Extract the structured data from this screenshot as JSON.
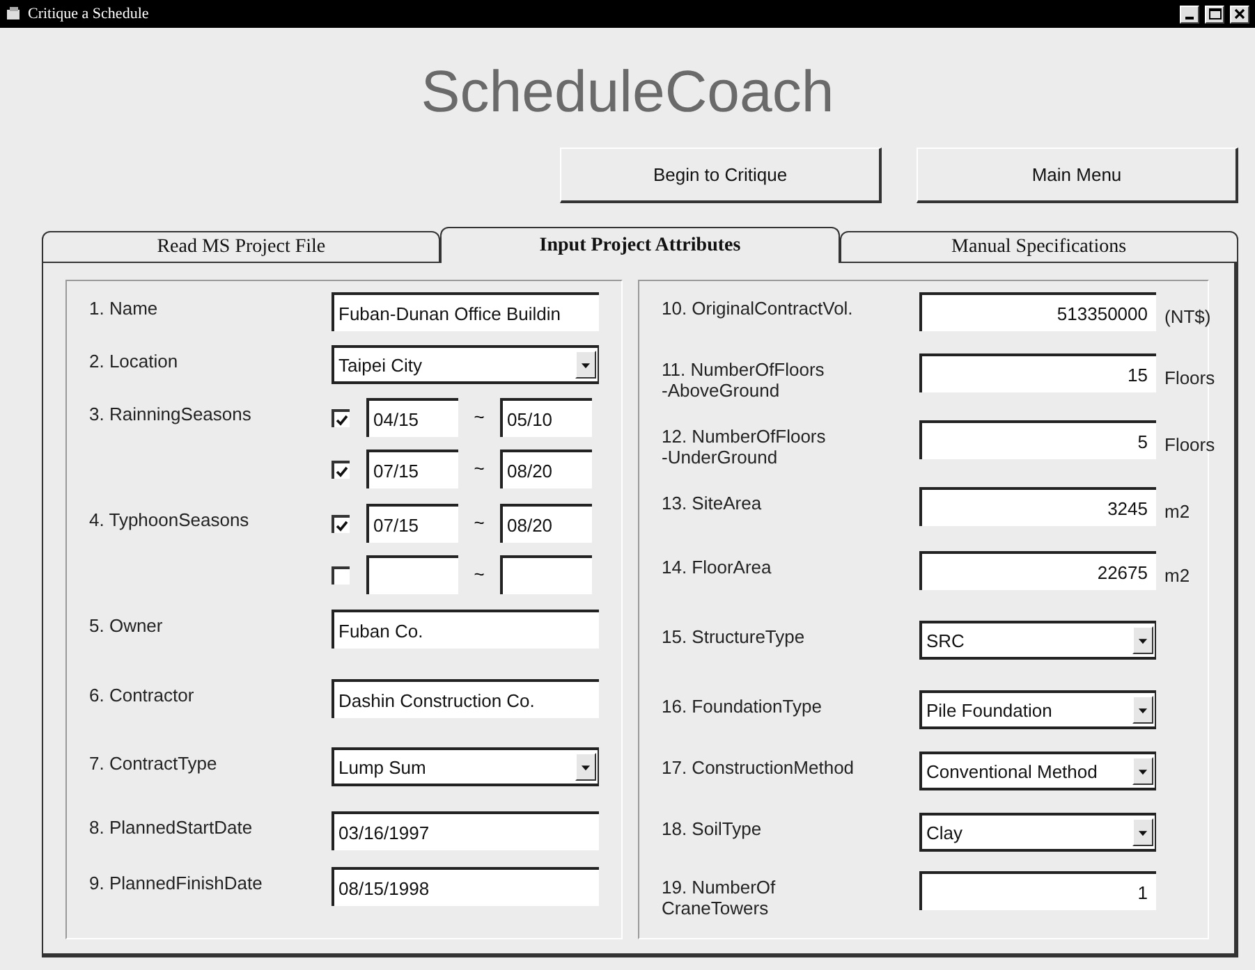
{
  "window": {
    "title": "Critique a Schedule"
  },
  "app_title": "ScheduleCoach",
  "buttons": [
    "Begin to Critique",
    "Main Menu"
  ],
  "tabs": [
    {
      "label": "Read MS Project File",
      "selected": false
    },
    {
      "label": "Input Project Attributes",
      "selected": true
    },
    {
      "label": "Manual Specifications",
      "selected": false
    }
  ],
  "left_fields": [
    {
      "kind": "text",
      "label": "1. Name",
      "value": "Fuban-Dunan Office Buildin"
    },
    {
      "kind": "select",
      "label": "2. Location",
      "value": "Taipei City"
    },
    {
      "kind": "seasons",
      "label": "3. RainningSeasons",
      "rows": [
        {
          "checked": true,
          "from": "04/15",
          "separator": "~",
          "to": "05/10"
        },
        {
          "checked": true,
          "from": "07/15",
          "separator": "~",
          "to": "08/20"
        }
      ]
    },
    {
      "kind": "seasons",
      "label": "4. TyphoonSeasons",
      "rows": [
        {
          "checked": true,
          "from": "07/15",
          "separator": "~",
          "to": "08/20"
        },
        {
          "checked": false,
          "separator": "~"
        }
      ]
    },
    {
      "kind": "text",
      "label": "5. Owner",
      "value": "Fuban Co."
    },
    {
      "kind": "text",
      "label": "6. Contractor",
      "value": "Dashin Construction Co."
    },
    {
      "kind": "select",
      "label": "7. ContractType",
      "value": "Lump Sum"
    },
    {
      "kind": "text",
      "label": "8. PlannedStartDate",
      "value": "03/16/1997"
    },
    {
      "kind": "text",
      "label": "9. PlannedFinishDate",
      "value": "08/15/1998"
    }
  ],
  "right_fields": [
    {
      "kind": "number",
      "label": "10. OriginalContractVol.",
      "value": "513350000",
      "unit": "(NT$)"
    },
    {
      "kind": "number",
      "label": "11. NumberOfFloors\n-AboveGround",
      "value": "15",
      "unit": "Floors"
    },
    {
      "kind": "number",
      "label": "12. NumberOfFloors\n-UnderGround",
      "value": "5",
      "unit": "Floors"
    },
    {
      "kind": "number",
      "label": "13. SiteArea",
      "value": "3245",
      "unit": "m2"
    },
    {
      "kind": "number",
      "label": "14. FloorArea",
      "value": "22675",
      "unit": "m2"
    },
    {
      "kind": "select",
      "label": "15. StructureType",
      "value": "SRC"
    },
    {
      "kind": "select",
      "label": "16. FoundationType",
      "value": "Pile Foundation"
    },
    {
      "kind": "select",
      "label": "17. ConstructionMethod",
      "value": "Conventional Method"
    },
    {
      "kind": "select",
      "label": "18. SoilType",
      "value": "Clay"
    },
    {
      "kind": "number",
      "label": "19. NumberOf\nCraneTowers",
      "value": "1"
    }
  ]
}
